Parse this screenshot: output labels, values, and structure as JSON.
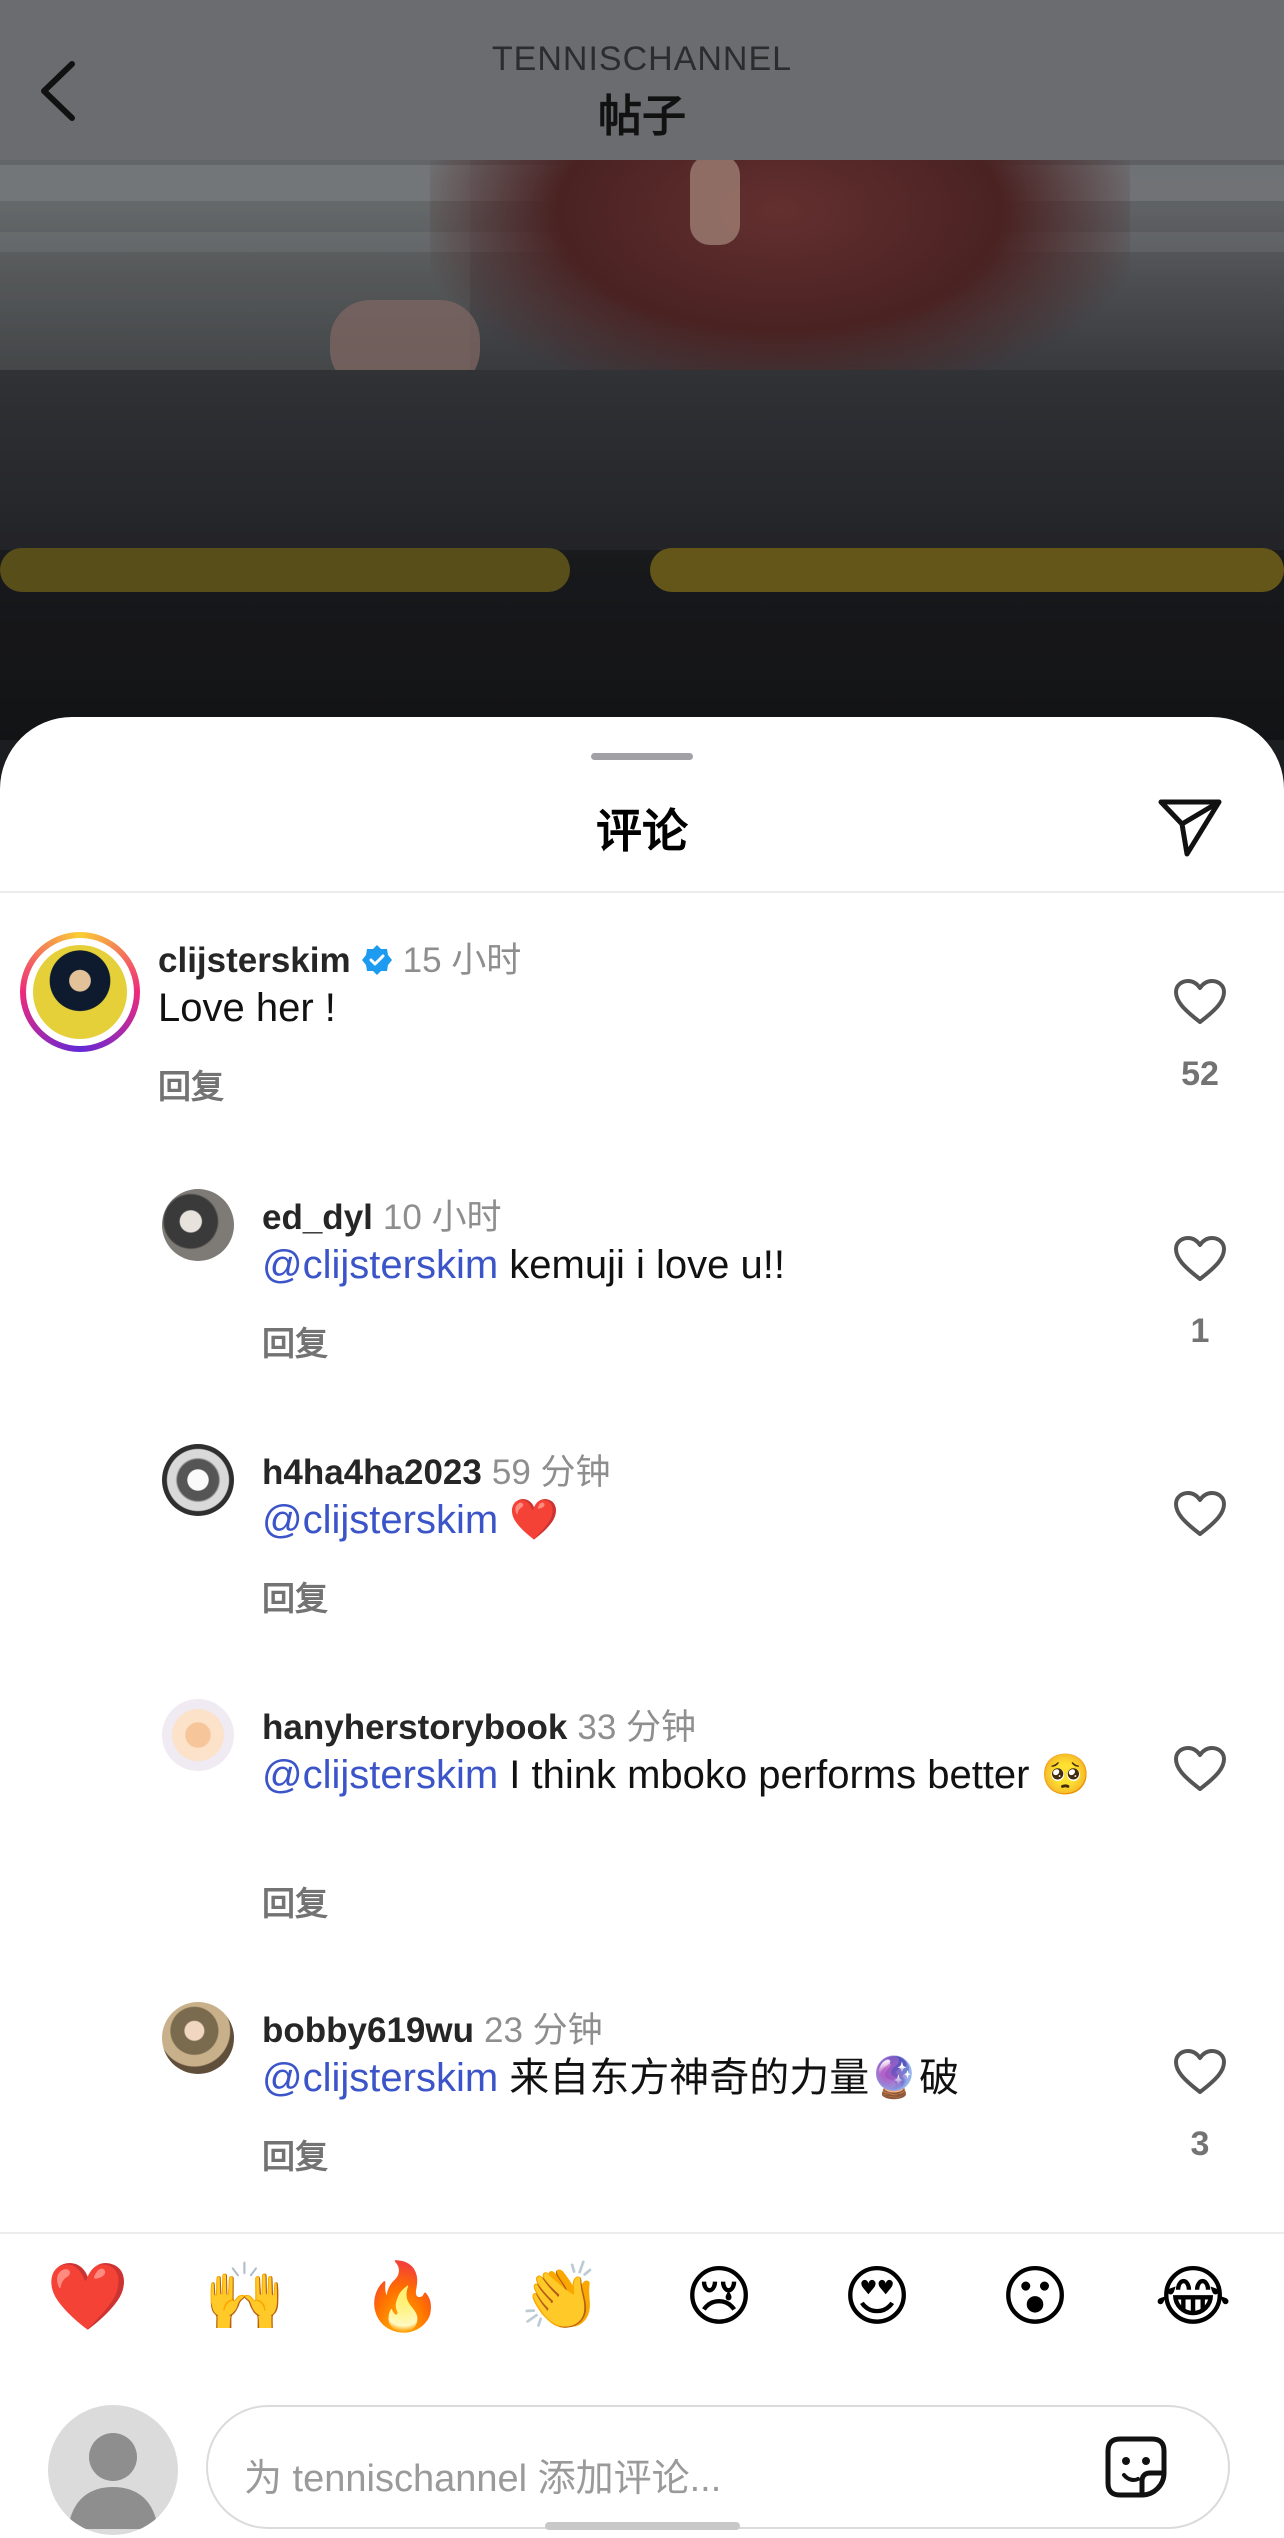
{
  "header": {
    "owner": "TENNISCHANNEL",
    "title": "帖子"
  },
  "sheet": {
    "title": "评论"
  },
  "comments": [
    {
      "username": "clijsterskim",
      "time": "15 小时",
      "verified": true,
      "text": "Love her !",
      "reply": "回复",
      "likes": "52"
    },
    {
      "username": "ed_dyl",
      "time": "10 小时",
      "mention": "@clijsterskim",
      "text": " kemuji i love u!!",
      "reply": "回复",
      "likes": "1"
    },
    {
      "username": "h4ha4ha2023",
      "time": "59 分钟",
      "mention": "@clijsterskim",
      "text": " ❤️",
      "reply": "回复",
      "likes": ""
    },
    {
      "username": "hanyherstorybook",
      "time": "33 分钟",
      "mention": "@clijsterskim",
      "text": " I think mboko performs better 🥺",
      "reply": "回复",
      "likes": ""
    },
    {
      "username": "bobby619wu",
      "time": "23 分钟",
      "mention": "@clijsterskim",
      "text": " 来自东方神奇的力量🔮破",
      "reply": "回复",
      "likes": "3"
    }
  ],
  "reactions": [
    "❤️",
    "🙌",
    "🔥",
    "👏",
    "😢",
    "😍",
    "😮",
    "😂"
  ],
  "composer": {
    "placeholder": "为 tennischannel 添加评论..."
  },
  "colors": {
    "mention": "#3b55c9",
    "verified": "#1d9bf0"
  }
}
